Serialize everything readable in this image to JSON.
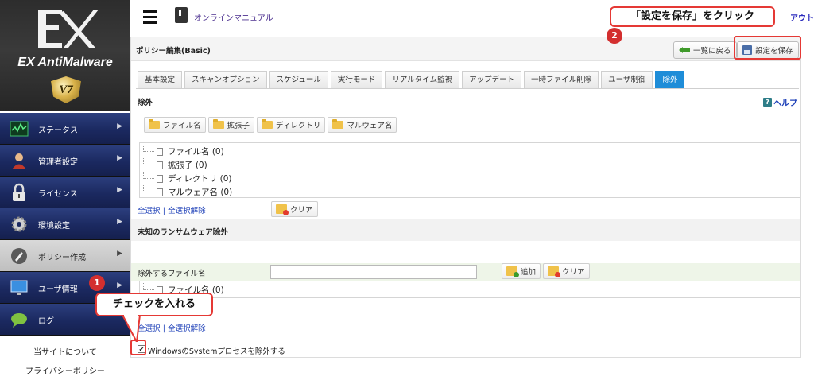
{
  "app": {
    "brand_name": "EX AntiMalware",
    "brand_version": "V7"
  },
  "sidebar": {
    "items": [
      {
        "label": "ステータス",
        "icon": "status-chart-icon"
      },
      {
        "label": "管理者設定",
        "icon": "admin-user-icon"
      },
      {
        "label": "ライセンス",
        "icon": "padlock-icon"
      },
      {
        "label": "環境設定",
        "icon": "gear-icon"
      },
      {
        "label": "ポリシー作成",
        "icon": "policy-icon"
      },
      {
        "label": "ユーザ情報",
        "icon": "monitor-icon"
      },
      {
        "label": "ログ",
        "icon": "chat-bubble-icon"
      }
    ],
    "footer": {
      "about": "当サイトについて",
      "privacy": "プライバシーポリシー"
    }
  },
  "topbar": {
    "manual": "オンラインマニュアル",
    "logout": "アウト"
  },
  "page": {
    "title": "ポリシー編集(Basic)",
    "back_button": "一覧に戻る",
    "save_button": "設定を保存"
  },
  "tabs": [
    "基本設定",
    "スキャンオプション",
    "スケジュール",
    "実行モード",
    "リアルタイム監視",
    "アップデート",
    "一時ファイル削除",
    "ユーザ制御",
    "除外"
  ],
  "active_tab": "除外",
  "exclusion": {
    "title": "除外",
    "help": "ヘルプ",
    "type_buttons": [
      "ファイル名",
      "拡張子",
      "ディレクトリ",
      "マルウェア名"
    ],
    "tree": [
      "ファイル名 (0)",
      "拡張子 (0)",
      "ディレクトリ (0)",
      "マルウェア名 (0)"
    ],
    "select_all": "全選択",
    "deselect_all": "全選択解除",
    "separator": "|",
    "clear": "クリア"
  },
  "ransomware": {
    "title": "未知のランサムウェア除外",
    "file_label": "除外するファイル名",
    "file_input_value": "",
    "add": "追加",
    "clear": "クリア",
    "tree": [
      "ファイル名 (0)"
    ],
    "select_all": "全選択",
    "deselect_all": "全選択解除",
    "separator": "|",
    "checkbox_label": "WindowsのSystemプロセスを除外する",
    "checkbox_checked": true
  },
  "annotations": {
    "step1_number": "1",
    "step1_text": "チェックを入れる",
    "step2_number": "2",
    "step2_text": "「設定を保存」をクリック",
    "accent_color": "#e53935"
  },
  "colors": {
    "active_tab": "#1f8dd8",
    "sidebar_nav": "#1b2960"
  }
}
